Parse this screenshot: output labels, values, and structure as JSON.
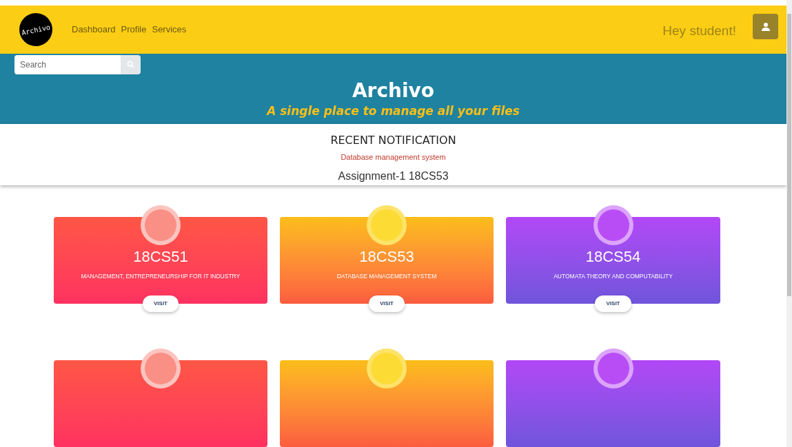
{
  "header": {
    "logo": "Archivo",
    "nav": [
      "Dashboard",
      "Profile",
      "Services"
    ],
    "greeting": "Hey student!"
  },
  "search": {
    "placeholder": "Search"
  },
  "hero": {
    "title": "Archivo",
    "subtitle": "A single place to manage all your files"
  },
  "notifications": {
    "title": "RECENT NOTIFICATION",
    "items": [
      {
        "kind": "subject",
        "text": "Database management system"
      },
      {
        "kind": "title",
        "text": "Assignment-1 18CS53"
      }
    ]
  },
  "courses": [
    {
      "kind": "red",
      "code": "18CS51",
      "name": "MANAGEMENT, ENTREPRENEURSHIP FOR IT INDUSTRY",
      "button": "VISIT"
    },
    {
      "kind": "orange",
      "code": "18CS53",
      "name": "DATABASE MANAGEMENT SYSTEM",
      "button": "VISIT"
    },
    {
      "kind": "purple",
      "code": "18CS54",
      "name": "AUTOMATA THEORY AND COMPUTABILITY",
      "button": "VISIT"
    },
    {
      "kind": "red"
    },
    {
      "kind": "orange"
    },
    {
      "kind": "purple"
    }
  ]
}
